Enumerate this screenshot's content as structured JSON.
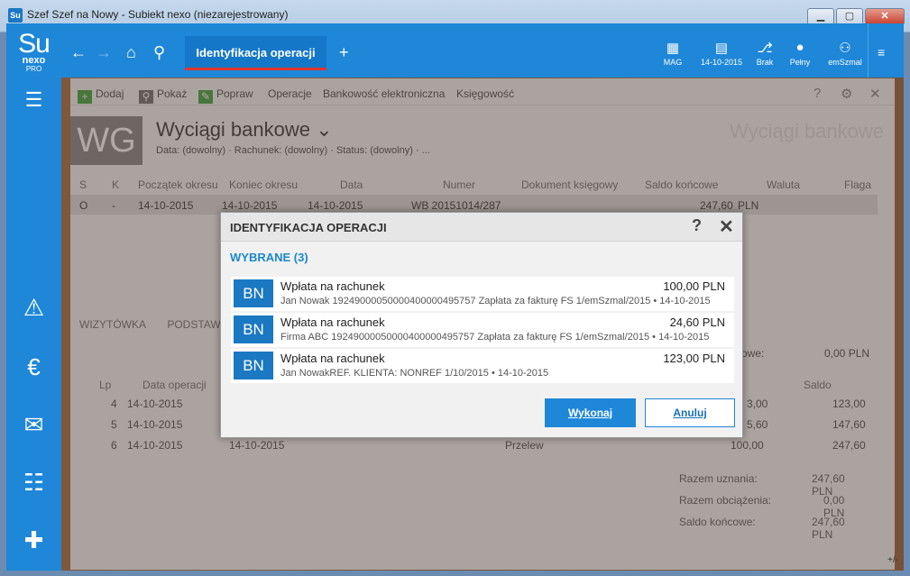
{
  "window": {
    "icon": "Su",
    "title": "Szef Szef na Nowy - Subiekt nexo (niezarejestrowany)"
  },
  "sidebar": {
    "logo": {
      "su": "Su",
      "nexo": "nexo",
      "pro": "PRO"
    },
    "icons": [
      "menu-icon",
      "alert-icon",
      "money-icon",
      "mail-icon",
      "certificate-icon",
      "health-icon"
    ]
  },
  "topbar": {
    "active_tab": "Identyfikacja operacji",
    "right_items": [
      {
        "icon": "building-icon",
        "label": "MAG"
      },
      {
        "icon": "calendar-icon",
        "label": "14-10-2015"
      },
      {
        "icon": "chart-icon",
        "label": "Brak"
      },
      {
        "icon": "circles-icon",
        "label": "Pełny"
      },
      {
        "icon": "network-icon",
        "label": "emSzmal"
      }
    ]
  },
  "actions": [
    "Dodaj",
    "Pokaż",
    "Popraw",
    "Operacje",
    "Bankowość elektroniczna",
    "Księgowość"
  ],
  "header": {
    "badge": "WG",
    "title": "Wyciągi bankowe",
    "subtitle": "Data: (dowolny) · Rachunek: (dowolny) · Status: (dowolny) · ...",
    "ghost": "Wyciągi bankowe"
  },
  "grid": {
    "columns": [
      "S",
      "K",
      "Początek okresu",
      "Koniec okresu",
      "Data",
      "Numer",
      "Dokument księgowy",
      "Saldo końcowe",
      "Waluta",
      "Flaga"
    ],
    "row": [
      "O",
      "-",
      "14-10-2015",
      "14-10-2015",
      "14-10-2015",
      "WB 20151014/287",
      "",
      "247,60",
      "PLN",
      ""
    ]
  },
  "lower_tabs": [
    "Wizytówka",
    "Podstawo"
  ],
  "saldo_top": {
    "label": "cowe:",
    "value": "0,00 PLN"
  },
  "grid2": {
    "columns": [
      "Lp",
      "Data operacji",
      "Saldo"
    ],
    "rows": [
      {
        "lp": "4",
        "date": "14-10-2015",
        "date2": "",
        "type": "",
        "amount": "3,00",
        "saldo": "123,00"
      },
      {
        "lp": "5",
        "date": "14-10-2015",
        "date2": "",
        "type": "",
        "amount": "5,60",
        "saldo": "147,60"
      },
      {
        "lp": "6",
        "date": "14-10-2015",
        "date2": "14-10-2015",
        "type": "Przelew",
        "amount": "100,00",
        "saldo": "247,60"
      }
    ]
  },
  "summary": [
    {
      "label": "Razem uznania:",
      "value": "247,60 PLN"
    },
    {
      "label": "Razem obciążenia:",
      "value": "0,00 PLN"
    },
    {
      "label": "Saldo końcowe:",
      "value": "247,60 PLN"
    }
  ],
  "dialog": {
    "title": "IDENTYFIKACJA OPERACJI",
    "help": "?",
    "close": "✕",
    "section": "WYBRANE (3)",
    "operations": [
      {
        "badge": "BN",
        "name": "Wpłata na rachunek",
        "amount": "100,00 PLN",
        "desc": "Jan Nowak 19249000050000400000495757 Zapłata za fakturę FS 1/emSzmal/2015  • 14-10-2015"
      },
      {
        "badge": "BN",
        "name": "Wpłata na rachunek",
        "amount": "24,60 PLN",
        "desc": "Firma ABC 19249000050000400000495757 Zapłata za fakturę FS 1/emSzmal/2015  • 14-10-2015"
      },
      {
        "badge": "BN",
        "name": "Wpłata na rachunek",
        "amount": "123,00 PLN",
        "desc": "Jan NowakREF. KLIENTA: NONREF 1/10/2015   • 14-10-2015"
      }
    ],
    "ok_label": "Wykonaj",
    "cancel_label": "Anuluj"
  },
  "corner": "+/-"
}
